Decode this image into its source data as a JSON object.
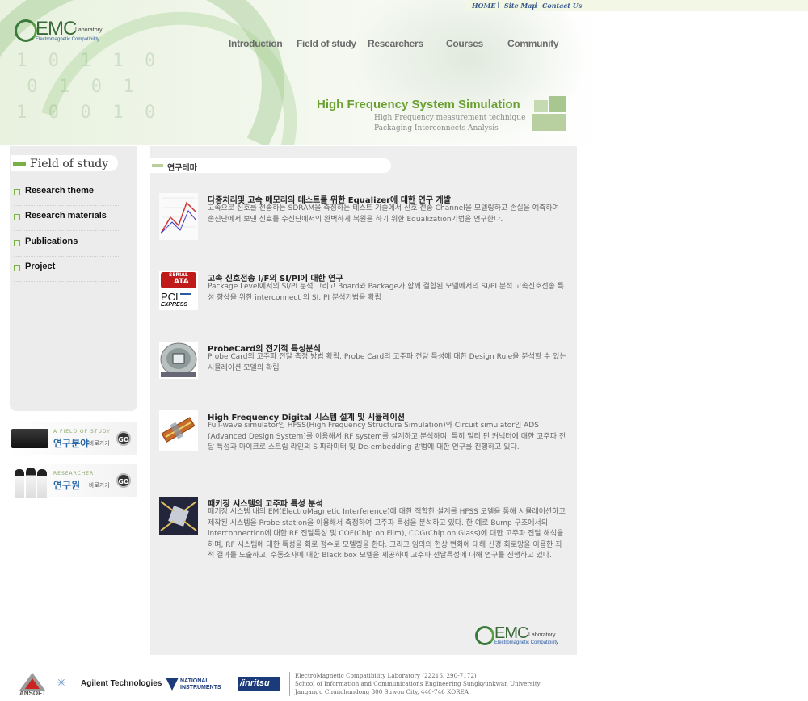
{
  "topbar": {
    "home": "HOME",
    "sitemap": "Site Map",
    "contact": "Contact Us",
    "separator": "|"
  },
  "logo": {
    "emc": "EMC",
    "laboratory": "Laboratory",
    "subtitle": "Electromagnetic Compatibility"
  },
  "nav": [
    "Introduction",
    "Field of study",
    "Researchers",
    "Courses",
    "Community"
  ],
  "hero": {
    "title": "High Frequency System Simulation",
    "sub1": "High Frequency measurement technique",
    "sub2": "Packaging Interconnects Analysis"
  },
  "sidebar": {
    "title": "Field of study",
    "items": [
      {
        "label": "Research theme"
      },
      {
        "label": "Research materials"
      },
      {
        "label": "Publications"
      },
      {
        "label": "Project"
      }
    ]
  },
  "banners": [
    {
      "small": "A FIELD OF STUDY",
      "big": "연구분야",
      "go_label": "바로가기",
      "go": "GO"
    },
    {
      "small": "RESEARCHER",
      "big": "연구원",
      "go_label": "바로가기",
      "go": "GO"
    }
  ],
  "main": {
    "tab": "연구테마",
    "items": [
      {
        "title": "다중처리및 고속 메모리의 테스트를 위한 Equalizer에 대한 연구 개발",
        "desc": "고속으로 신호를 전송하는 SDRAM을 측정하는 테스트 기술에서 신호 전송 Channel을 모델링하고 손실을 예측하여 송신단에서 보낸 신호를 수신단에서의 완벽하게 복원을 하기 위한 Equalization기법을 연구한다."
      },
      {
        "title": "고속 신호전송 I/F의 SI/PI에 대한 연구",
        "desc": "Package Level에서의 SI/PI 분석 그리고 Board와 Package가 함께 결합된 모델에서의 SI/PI 분석 고속신호전송 특성 향상을 위한 interconnect 의 SI, PI 분석기법을 확립",
        "thumb_text": {
          "serial": "SERIAL",
          "ata": "ATA",
          "pci": "PCI",
          "express": "EXPRESS"
        }
      },
      {
        "title": "ProbeCard의 전기적 특성분석",
        "desc": "Probe Card의 고주파 전달 측정 방법 확립. Probe Card의 고주파 전달 특성에 대한 Design Rule을 분석할 수 있는 시뮬레이션 모델의 확립"
      },
      {
        "title": "High Frequency Digital 시스템 설계 및 시뮬레이션",
        "desc": "Full-wave simulator인 HFSS(High Frequency Structure Simulation)와 Circuit simulator인 ADS (Advanced Design System)를 이용해서 RF system를 설계하고 분석하며, 특히 멀티 핀 커넥터에 대한 고주파 전달 특성과 마이크로 스트립 라인의 S 파라미터 및 De-embedding 방법에 대한 연구를 진행하고 있다."
      },
      {
        "title": "패키징 시스템의 고주파 특성 분석",
        "desc": "패키징 시스템 내의 EM(ElectroMagnetic Interference)에 대한 적합한 설계를 HFSS 모델을 통해 시뮬레이션하고 제작된 시스템을 Probe station을 이용해서 측정하여 고주파 특성을 분석하고 있다. 한 예로 Bump 구조에서의 interconnection에 대한 RF 전달특성 및 COF(Chip on Film), COG(Chip on Glass)에 대한 고주파 전달 해석을 하며, RF 시스템에 대한 특성을 회로 정수로 모델링을 한다. 그리고 임의의 현상 변화에 대해 신경 회로망을 이용한 최적 결과를 도출하고, 수동소자에 대한 Black box 모델을 제공하여 고주파 전달특성에 대해 연구를 진행하고 있다."
      }
    ]
  },
  "footer": {
    "partners": [
      "ANSOFT",
      "Agilent Technologies",
      "NATIONAL INSTRUMENTS",
      "/inritsu"
    ],
    "address": [
      "ElectroMagnetic Compatibility Laboratory (22216, 290-7172)",
      "School of Information and Communications Engineering Sungkyunkwan University",
      "Jangangu Chunchundong 300 Suwon City, 440-746 KOREA"
    ]
  },
  "colors": {
    "accent_green": "#7ab048",
    "title_green": "#6aa030",
    "nav_gray": "#6b6b6b",
    "panel_gray": "#eeeeee"
  }
}
